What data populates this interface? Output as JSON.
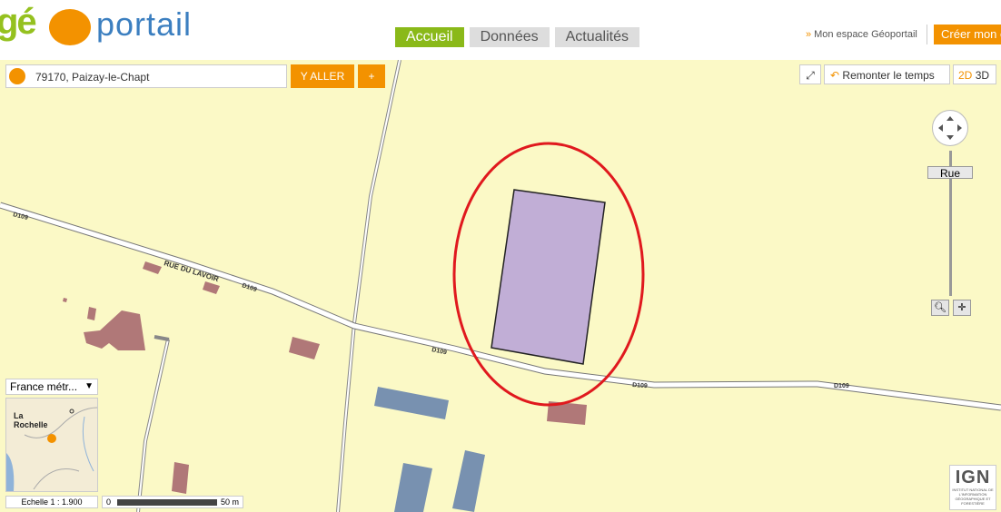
{
  "header": {
    "logo_geo": "gé",
    "logo_portail": "portail",
    "tabs": [
      {
        "label": "Accueil",
        "active": true
      },
      {
        "label": "Données",
        "active": false
      },
      {
        "label": "Actualités",
        "active": false
      }
    ],
    "espace_label": "Mon espace Géoportail",
    "create_label": "Créer mon e"
  },
  "search": {
    "value": "79170, Paizay-le-Chapt",
    "go_label": "Y ALLER",
    "plus_label": "+"
  },
  "toolbar": {
    "time_label": "Remonter le temps",
    "mode_2d": "2D",
    "mode_3d": "3D"
  },
  "zoom": {
    "level_label": "Rue"
  },
  "region_select": {
    "value": "France métr..."
  },
  "minimap": {
    "place": "La Rochelle"
  },
  "scale": {
    "label": "Echelle 1 :  1.900",
    "bar_start": "0",
    "bar_end": "50 m"
  },
  "map_labels": {
    "road_main": "D109",
    "street": "RUE DU LAVOIR"
  },
  "ign": {
    "logo": "IGN",
    "tagline": "INSTITUT NATIONAL DE L'INFORMATION GÉOGRAPHIQUE ET FORESTIÈRE"
  },
  "colors": {
    "brand_green": "#8ab919",
    "brand_orange": "#f39200",
    "map_background": "#fbf9c6",
    "building_red": "#b07878",
    "building_blue": "#7891b0",
    "parcel_highlight": "#c1aed6",
    "annotation_circle": "#e0191e"
  }
}
